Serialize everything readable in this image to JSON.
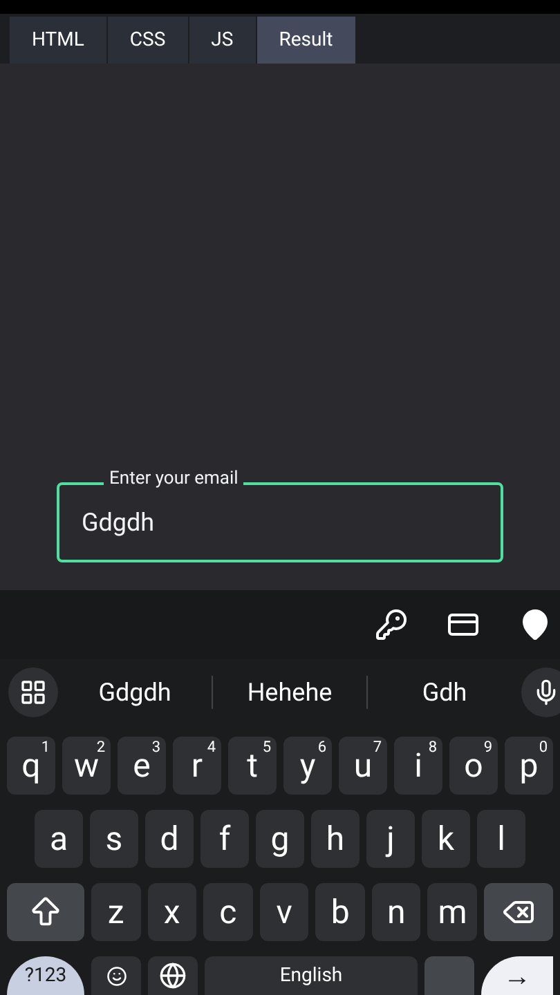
{
  "tabs": [
    {
      "label": "HTML",
      "selected": false
    },
    {
      "label": "CSS",
      "selected": false
    },
    {
      "label": "JS",
      "selected": false
    },
    {
      "label": "Result",
      "selected": true
    }
  ],
  "email_field": {
    "label": "Enter your email",
    "value": "Gdgdh"
  },
  "suggestions": [
    "Gdgdh",
    "Hehehe",
    "Gdh"
  ],
  "keyboard": {
    "letter_rows": [
      {
        "keys": [
          {
            "kind": "letter",
            "label": "q",
            "hint": "1"
          },
          {
            "kind": "letter",
            "label": "w",
            "hint": "2"
          },
          {
            "kind": "letter",
            "label": "e",
            "hint": "3"
          },
          {
            "kind": "letter",
            "label": "r",
            "hint": "4"
          },
          {
            "kind": "letter",
            "label": "t",
            "hint": "5"
          },
          {
            "kind": "letter",
            "label": "y",
            "hint": "6"
          },
          {
            "kind": "letter",
            "label": "u",
            "hint": "7"
          },
          {
            "kind": "letter",
            "label": "i",
            "hint": "8"
          },
          {
            "kind": "letter",
            "label": "o",
            "hint": "9"
          },
          {
            "kind": "letter",
            "label": "p",
            "hint": "0"
          }
        ]
      },
      {
        "keys": [
          {
            "kind": "letter",
            "label": "a"
          },
          {
            "kind": "letter",
            "label": "s"
          },
          {
            "kind": "letter",
            "label": "d"
          },
          {
            "kind": "letter",
            "label": "f"
          },
          {
            "kind": "letter",
            "label": "g"
          },
          {
            "kind": "letter",
            "label": "h"
          },
          {
            "kind": "letter",
            "label": "j"
          },
          {
            "kind": "letter",
            "label": "k"
          },
          {
            "kind": "letter",
            "label": "l"
          }
        ]
      },
      {
        "keys": [
          {
            "kind": "shift"
          },
          {
            "kind": "letter",
            "label": "z"
          },
          {
            "kind": "letter",
            "label": "x"
          },
          {
            "kind": "letter",
            "label": "c"
          },
          {
            "kind": "letter",
            "label": "v"
          },
          {
            "kind": "letter",
            "label": "b"
          },
          {
            "kind": "letter",
            "label": "n"
          },
          {
            "kind": "letter",
            "label": "m"
          },
          {
            "kind": "backspace"
          }
        ]
      }
    ],
    "bottom_row": [
      {
        "kind": "symbols",
        "label": "?123"
      },
      {
        "kind": "emoji"
      },
      {
        "kind": "globe"
      },
      {
        "kind": "space",
        "label": "English"
      },
      {
        "kind": "blank"
      },
      {
        "kind": "enter",
        "label": "→"
      }
    ]
  }
}
